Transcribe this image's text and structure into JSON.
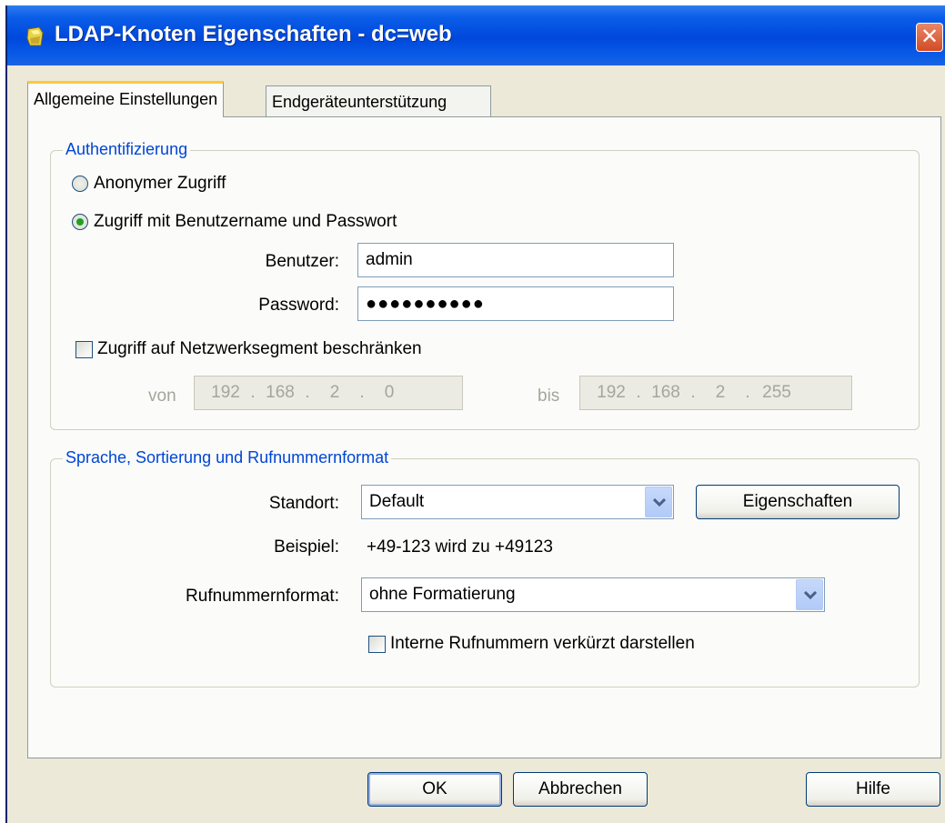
{
  "window": {
    "title": "LDAP-Knoten Eigenschaften - dc=web",
    "close_symbol": "✕",
    "icon": "ldap-node-icon"
  },
  "tabs": [
    {
      "label": "Allgemeine Einstellungen",
      "active": true
    },
    {
      "label": "Endgeräteunterstützung",
      "active": false
    }
  ],
  "auth": {
    "legend": "Authentifizierung",
    "radio_anonymous": "Anonymer Zugriff",
    "radio_credentials": "Zugriff mit Benutzername und Passwort",
    "selected": "credentials",
    "user_label": "Benutzer:",
    "user_value": "admin",
    "password_label": "Password:",
    "password_value": "●●●●●●●●●●",
    "restrict_label": "Zugriff auf Netzwerksegment beschränken",
    "restrict_checked": false,
    "from_label": "von",
    "from_ip": [
      "192",
      "168",
      "2",
      "0"
    ],
    "to_label": "bis",
    "to_ip": [
      "192",
      "168",
      "2",
      "255"
    ],
    "ip_separator": "."
  },
  "lang": {
    "legend": "Sprache, Sortierung und Rufnummernformat",
    "location_label": "Standort:",
    "location_value": "Default",
    "properties_button": "Eigenschaften",
    "example_label": "Beispiel:",
    "example_value": "+49-123 wird zu +49123",
    "format_label": "Rufnummernformat:",
    "format_value": "ohne Formatierung",
    "short_internal_label": "Interne Rufnummern verkürzt darstellen",
    "short_internal_checked": false
  },
  "buttons": {
    "ok": "OK",
    "cancel": "Abbrechen",
    "help": "Hilfe"
  },
  "colors": {
    "titlebar": "#0048dc",
    "legend_text": "#0046d5",
    "active_tab_accent": "#ffc83c",
    "radio_selected": "#21a121",
    "close_button": "#d34a23"
  }
}
